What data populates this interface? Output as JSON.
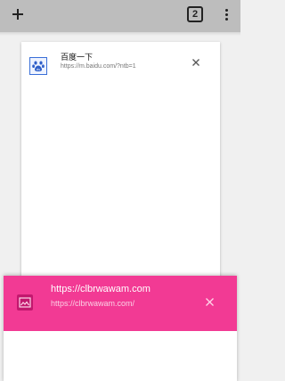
{
  "toolbar": {
    "new_tab_icon": "plus-icon",
    "tab_count": "2",
    "menu_icon": "more-vert-icon"
  },
  "tabs": [
    {
      "title": "百度一下",
      "url": "https://m.baidu.com/?ntb=1",
      "favicon": "baidu-paw-icon",
      "close_icon": "close-icon"
    },
    {
      "title": "https://clbrwawam.com",
      "url": "https://clbrwawam.com/",
      "favicon": "image-placeholder-icon",
      "close_icon": "close-icon",
      "accent_color": "#f23a94"
    }
  ]
}
